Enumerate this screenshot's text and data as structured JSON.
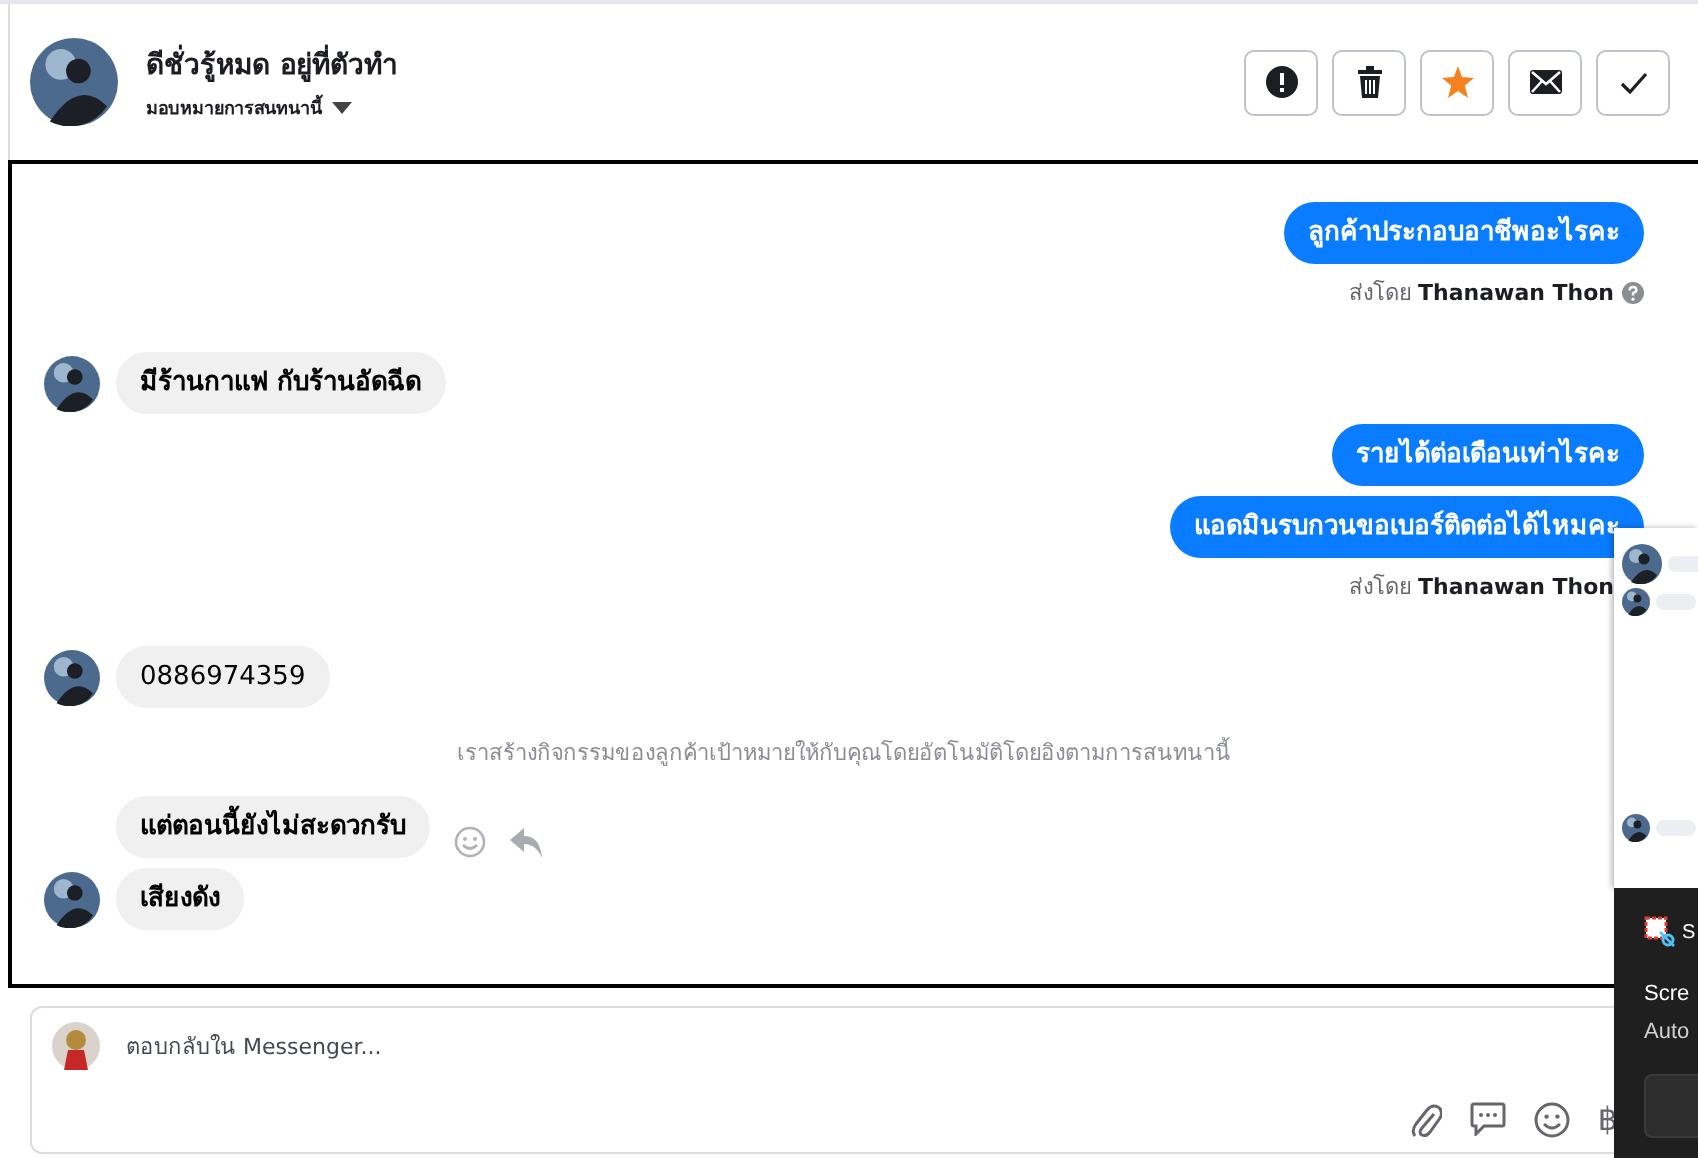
{
  "header": {
    "name": "ดีชั่วรู้หมด อยู่ที่ตัวทำ",
    "assign": "มอบหมายการสนทนานี้"
  },
  "actions": [
    {
      "kind": "alert"
    },
    {
      "kind": "trash"
    },
    {
      "kind": "star"
    },
    {
      "kind": "mail"
    },
    {
      "kind": "check"
    }
  ],
  "messages": [
    {
      "kind": "out",
      "text": "ลูกค้าประกอบอาชีพอะไรคะ"
    },
    {
      "kind": "sent_by",
      "text": "ส่งโดย **Thanawan Thon**",
      "info": true
    },
    {
      "kind": "in",
      "text": "มีร้านกาแฟ กับร้านอัดฉีด",
      "avatar": true,
      "bold": true
    },
    {
      "kind": "out",
      "text": "รายได้ต่อเดือนเท่าไรคะ"
    },
    {
      "kind": "out",
      "text": "แอดมินรบกวนขอเบอร์ติดต่อได้ไหมคะ"
    },
    {
      "kind": "sent_by",
      "text": "ส่งโดย **Thanawan Thon**",
      "info": false
    },
    {
      "kind": "in",
      "text": "0886974359",
      "avatar": true,
      "bold": false
    },
    {
      "kind": "system",
      "text": "เราสร้างกิจกรรมของลูกค้าเป้าหมายให้กับคุณโดยอัตโนมัติโดยอิงตามการสนทนานี้"
    },
    {
      "kind": "in",
      "text": "แต่ตอนนี้ยังไม่สะดวกรับ",
      "avatar": false,
      "bold": true,
      "tools": true
    },
    {
      "kind": "in",
      "text": "เสียงดัง",
      "avatar": true,
      "bold": true
    }
  ],
  "composer": {
    "placeholder": "ตอบกลับใน Messenger...",
    "currency": "฿"
  },
  "toast": {
    "app": "S",
    "heading": "Scre",
    "body": "Auto"
  }
}
